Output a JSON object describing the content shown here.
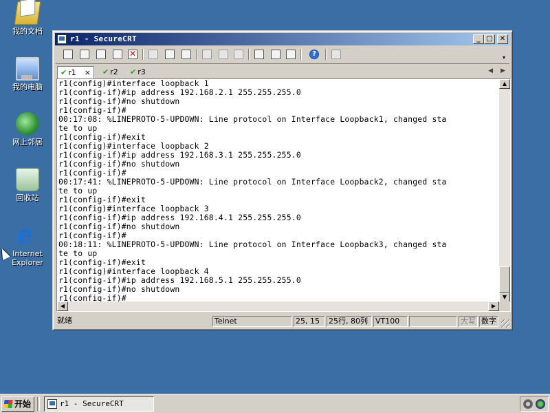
{
  "desktop": {
    "icons": [
      {
        "label": "我的文档",
        "icon": "my-documents-icon"
      },
      {
        "label": "我的电脑",
        "icon": "my-computer-icon"
      },
      {
        "label": "网上邻居",
        "icon": "network-places-icon"
      },
      {
        "label": "回收站",
        "icon": "recycle-bin-icon"
      },
      {
        "label": "Internet\nExplorer",
        "icon": "internet-explorer-icon"
      }
    ]
  },
  "window": {
    "title": "r1 - SecureCRT",
    "tabs": [
      {
        "label": "r1",
        "active": true,
        "close": "×"
      },
      {
        "label": "r2",
        "active": false
      },
      {
        "label": "r3",
        "active": false
      }
    ],
    "terminal_lines": [
      "r1(config)#interface loopback 1",
      "r1(config-if)#ip address 192.168.2.1 255.255.255.0",
      "r1(config-if)#no shutdown",
      "r1(config-if)#",
      "00:17:08: %LINEPROTO-5-UPDOWN: Line protocol on Interface Loopback1, changed sta",
      "te to up",
      "r1(config-if)#exit",
      "r1(config)#interface loopback 2",
      "r1(config-if)#ip address 192.168.3.1 255.255.255.0",
      "r1(config-if)#no shutdown",
      "r1(config-if)#",
      "00:17:41: %LINEPROTO-5-UPDOWN: Line protocol on Interface Loopback2, changed sta",
      "te to up",
      "r1(config-if)#exit",
      "r1(config)#interface loopback 3",
      "r1(config-if)#ip address 192.168.4.1 255.255.255.0",
      "r1(config-if)#no shutdown",
      "r1(config-if)#",
      "00:18:11: %LINEPROTO-5-UPDOWN: Line protocol on Interface Loopback3, changed sta",
      "te to up",
      "r1(config-if)#exit",
      "r1(config)#interface loopback 4",
      "r1(config-if)#ip address 192.168.5.1 255.255.255.0",
      "r1(config-if)#no shutdown",
      "r1(config-if)#"
    ],
    "status": {
      "ready": "就绪",
      "protocol": "Telnet",
      "cursor_pos": "25, 15",
      "rows_cols": "25行, 80列",
      "emulation": "VT100",
      "caps": "大写",
      "num": "数字"
    }
  },
  "taskbar": {
    "start_label": "开始",
    "task_title": "r1 - SecureCRT"
  }
}
